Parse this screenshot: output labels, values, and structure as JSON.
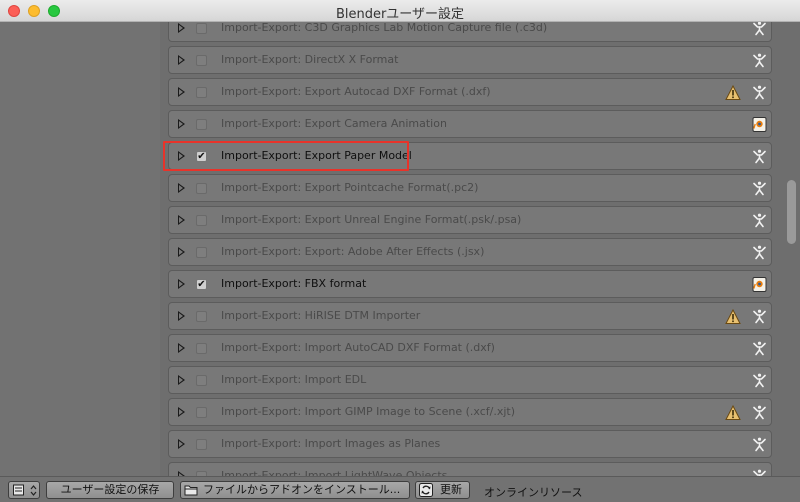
{
  "window": {
    "title": "Blenderユーザー設定"
  },
  "addons": [
    {
      "name": "Import-Export: C3D Graphics Lab Motion Capture file (.c3d)",
      "enabled": false,
      "warning": false,
      "badge": "community-icon"
    },
    {
      "name": "Import-Export: DirectX X Format",
      "enabled": false,
      "warning": false,
      "badge": "community-icon"
    },
    {
      "name": "Import-Export: Export Autocad DXF Format (.dxf)",
      "enabled": false,
      "warning": true,
      "badge": "community-icon"
    },
    {
      "name": "Import-Export: Export Camera Animation",
      "enabled": false,
      "warning": false,
      "badge": "official-icon"
    },
    {
      "name": "Import-Export: Export Paper Model",
      "enabled": true,
      "warning": false,
      "badge": "community-icon"
    },
    {
      "name": "Import-Export: Export Pointcache Format(.pc2)",
      "enabled": false,
      "warning": false,
      "badge": "community-icon"
    },
    {
      "name": "Import-Export: Export Unreal Engine Format(.psk/.psa)",
      "enabled": false,
      "warning": false,
      "badge": "community-icon"
    },
    {
      "name": "Import-Export: Export: Adobe After Effects (.jsx)",
      "enabled": false,
      "warning": false,
      "badge": "community-icon"
    },
    {
      "name": "Import-Export: FBX format",
      "enabled": true,
      "warning": false,
      "badge": "official-icon"
    },
    {
      "name": "Import-Export: HiRISE DTM Importer",
      "enabled": false,
      "warning": true,
      "badge": "community-icon"
    },
    {
      "name": "Import-Export: Import AutoCAD DXF Format (.dxf)",
      "enabled": false,
      "warning": false,
      "badge": "community-icon"
    },
    {
      "name": "Import-Export: Import EDL",
      "enabled": false,
      "warning": false,
      "badge": "community-icon"
    },
    {
      "name": "Import-Export: Import GIMP Image to Scene (.xcf/.xjt)",
      "enabled": false,
      "warning": true,
      "badge": "community-icon"
    },
    {
      "name": "Import-Export: Import Images as Planes",
      "enabled": false,
      "warning": false,
      "badge": "community-icon"
    },
    {
      "name": "Import-Export: Import LightWave Objects",
      "enabled": false,
      "warning": false,
      "badge": "community-icon"
    }
  ],
  "bottombar": {
    "save_label": "ユーザー設定の保存",
    "install_label": "ファイルからアドオンをインストール...",
    "refresh_label": "更新",
    "online_label": "オンラインリソース"
  }
}
